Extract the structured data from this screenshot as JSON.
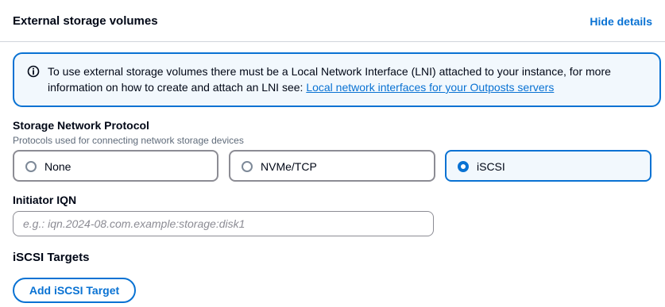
{
  "section": {
    "title": "External storage volumes",
    "hide_details_label": "Hide details"
  },
  "info": {
    "text": "To use external storage volumes there must be a Local Network Interface (LNI) attached to your instance, for more information on how to create and attach an LNI see: ",
    "link_text": "Local network interfaces for your Outposts servers",
    "icon": "info-icon",
    "accent_color": "#0972d3"
  },
  "protocol": {
    "label": "Storage Network Protocol",
    "description": "Protocols used for connecting network storage devices",
    "options": [
      {
        "label": "None",
        "selected": false
      },
      {
        "label": "NVMe/TCP",
        "selected": false
      },
      {
        "label": "iSCSI",
        "selected": true
      }
    ]
  },
  "initiator": {
    "label": "Initiator IQN",
    "value": "",
    "placeholder": "e.g.: iqn.2024-08.com.example:storage:disk1"
  },
  "targets": {
    "heading": "iSCSI Targets",
    "add_button_label": "Add iSCSI Target"
  }
}
